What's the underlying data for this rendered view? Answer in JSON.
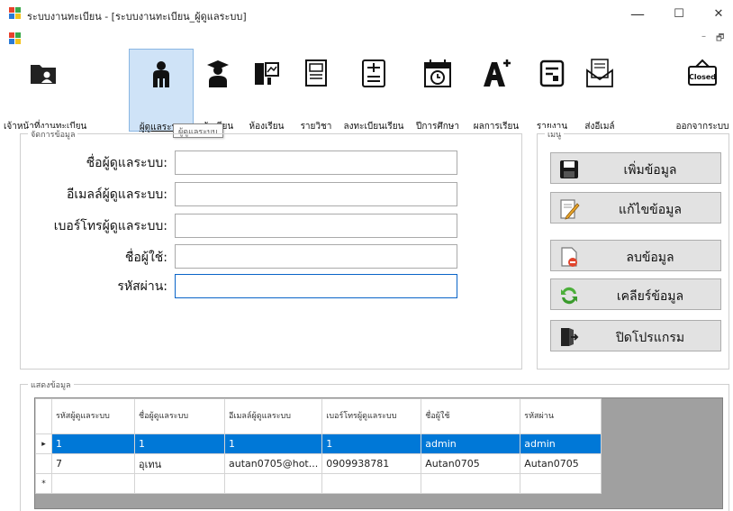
{
  "window": {
    "title": "ระบบงานทะเบียน - [ระบบงานทะเบียน_ผู้ดูแลระบบ]",
    "minimize_glyph": "—",
    "maximize_glyph": "☐",
    "close_glyph": "✕",
    "mdi_minimize_glyph": "–",
    "mdi_restore_glyph": "🗗"
  },
  "toolbar": {
    "items": [
      {
        "label": "เจ้าหน้าที่งานทะเบียน",
        "icon": "folder-user-icon"
      },
      {
        "label": "ผู้ดูแลระบบ",
        "icon": "admin-user-icon",
        "active": true
      },
      {
        "label": "นักเรียน",
        "icon": "student-graduate-icon"
      },
      {
        "label": "ห้องเรียน",
        "icon": "classroom-icon"
      },
      {
        "label": "รายวิชา",
        "icon": "book-icon"
      },
      {
        "label": "ลงทะเบียนเรียน",
        "icon": "register-list-icon"
      },
      {
        "label": "ปีการศึกษา",
        "icon": "calendar-clock-icon"
      },
      {
        "label": "ผลการเรียน",
        "icon": "grade-a-plus-icon"
      },
      {
        "label": "รายงาน",
        "icon": "report-icon"
      },
      {
        "label": "ส่งอีเมล์",
        "icon": "email-doc-icon"
      },
      {
        "label": "ออกจากระบบ",
        "icon": "closed-sign-icon",
        "sign_text": "Closed"
      }
    ],
    "tooltip": "ผู้ดูแลระบบ"
  },
  "manage_group": {
    "title": "จัดการข้อมูล",
    "fields": [
      {
        "label": "ชื่อผู้ดูแลระบบ:",
        "value": ""
      },
      {
        "label": "อีเมลล์ผู้ดูแลระบบ:",
        "value": ""
      },
      {
        "label": "เบอร์โทรผู้ดูแลระบบ:",
        "value": ""
      },
      {
        "label": "ชื่อผู้ใช้:",
        "value": ""
      },
      {
        "label": "รหัสผ่าน:",
        "value": ""
      }
    ]
  },
  "menu_group": {
    "title": "เมนู",
    "buttons": [
      {
        "label": "เพิ่มข้อมูล",
        "icon": "floppy-disk-icon"
      },
      {
        "label": "แก้ไขข้อมูล",
        "icon": "edit-pencil-icon"
      },
      {
        "label": "ลบข้อมูล",
        "icon": "delete-document-icon"
      },
      {
        "label": "เคลียร์ข้อมูล",
        "icon": "refresh-icon"
      },
      {
        "label": "ปิดโปรแกรม",
        "icon": "exit-door-icon"
      }
    ]
  },
  "display_group": {
    "title": "แสดงข้อมูล",
    "columns": [
      "รหัสผู้ดูแลระบบ",
      "ชื่อผู้ดูแลระบบ",
      "อีเมลล์ผู้ดูแลระบบ",
      "เบอร์โทรผู้ดูแลระบบ",
      "ชื่อผู้ใช้",
      "รหัสผ่าน"
    ],
    "rows": [
      {
        "indicator": "▸",
        "cells": [
          "1",
          "1",
          "1",
          "1",
          "admin",
          "admin"
        ],
        "selected": true
      },
      {
        "indicator": "",
        "cells": [
          "7",
          "อุเทน",
          "autan0705@hot...",
          "0909938781",
          "Autan0705",
          "Autan0705"
        ],
        "selected": false
      },
      {
        "indicator": "*",
        "cells": [
          "",
          "",
          "",
          "",
          "",
          ""
        ],
        "selected": false
      }
    ]
  },
  "colors": {
    "selection": "#0078d7",
    "active_tool": "#cfe3f7",
    "button_face": "#e2e2e2"
  }
}
